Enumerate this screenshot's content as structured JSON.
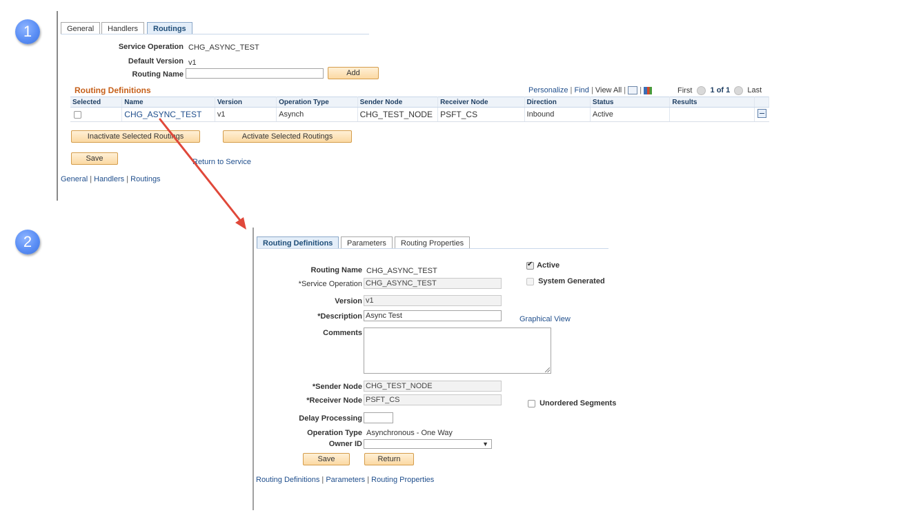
{
  "steps": [
    "1",
    "2"
  ],
  "panel1": {
    "tabs": [
      "General",
      "Handlers",
      "Routings"
    ],
    "service_operation_label": "Service Operation",
    "service_operation_value": "CHG_ASYNC_TEST",
    "default_version_label": "Default Version",
    "default_version_value": "v1",
    "routing_name_label": "Routing Name",
    "routing_name_value": "",
    "add_button": "Add",
    "grid_title": "Routing Definitions",
    "grid_tools": {
      "personalize": "Personalize",
      "find": "Find",
      "view_all": "View All",
      "first": "First",
      "page_info": "1 of 1",
      "last": "Last"
    },
    "columns": [
      "Selected",
      "Name",
      "Version",
      "Operation Type",
      "Sender Node",
      "Receiver Node",
      "Direction",
      "Status",
      "Results"
    ],
    "row": {
      "name": "CHG_ASYNC_TEST",
      "version": "v1",
      "operation_type": "Asynch",
      "sender_node": "CHG_TEST_NODE",
      "receiver_node": "PSFT_CS",
      "direction": "Inbound",
      "status": "Active",
      "results": ""
    },
    "inactivate_button": "Inactivate Selected Routings",
    "activate_button": "Activate Selected Routings",
    "save_button": "Save",
    "return_link": "Return to Service",
    "footer_links": [
      "General",
      "Handlers",
      "Routings"
    ]
  },
  "panel2": {
    "tabs": [
      "Routing Definitions",
      "Parameters",
      "Routing Properties"
    ],
    "routing_name_label": "Routing Name",
    "routing_name_value": "CHG_ASYNC_TEST",
    "service_operation_label": "*Service Operation",
    "service_operation_value": "CHG_ASYNC_TEST",
    "version_label": "Version",
    "version_value": "v1",
    "description_label": "*Description",
    "description_value": "Async Test",
    "comments_label": "Comments",
    "comments_value": "",
    "sender_node_label": "*Sender Node",
    "sender_node_value": "CHG_TEST_NODE",
    "receiver_node_label": "*Receiver Node",
    "receiver_node_value": "PSFT_CS",
    "delay_processing_label": "Delay Processing",
    "delay_processing_value": "",
    "operation_type_label": "Operation Type",
    "operation_type_value": "Asynchronous - One Way",
    "owner_id_label": "Owner ID",
    "owner_id_value": "",
    "active_label": "Active",
    "system_generated_label": "System Generated",
    "graphical_view_link": "Graphical View",
    "unordered_segments_label": "Unordered Segments",
    "save_button": "Save",
    "return_button": "Return",
    "footer_links": [
      "Routing Definitions",
      "Parameters",
      "Routing Properties"
    ]
  },
  "colors": {
    "step_badge": "#5a8ef5",
    "arrow": "#e0483a",
    "link": "#1f4e8c",
    "button_fill": "#fbd9a3",
    "grid_title": "#c6601a"
  }
}
